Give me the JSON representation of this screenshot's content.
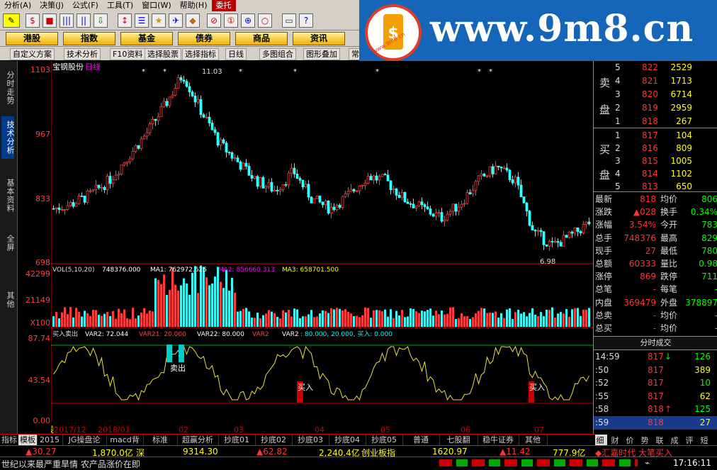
{
  "menu": {
    "items": [
      "分析(A)",
      "决策(J)",
      "公式(F)",
      "工具(T)",
      "窗口(W)",
      "帮助(H)",
      "委托"
    ]
  },
  "toolbar_icons": [
    "$",
    "■",
    "|||",
    "||",
    "⇩",
    "↕",
    "☰",
    "★",
    "✈",
    "◆",
    "⊘",
    "①",
    "⊕",
    "○",
    "▭",
    "?"
  ],
  "toolbar2": {
    "buttons": [
      "港股",
      "指数",
      "基金",
      "债券",
      "商品",
      "资讯"
    ]
  },
  "toolbar3": {
    "buttons": [
      "自定义方案",
      "技术分析",
      "F10资料",
      "选择股票",
      "选择指标",
      "日线",
      "多图组合",
      "图形叠加",
      "常"
    ]
  },
  "logo": {
    "text": "www.9m8.cn",
    "sub": "www.9m8.cn"
  },
  "left_tabs": [
    "分时走势",
    "技术分析",
    "基本资料",
    "全屏",
    "其他"
  ],
  "chart": {
    "stock_label": "宝钢股份",
    "period": "日线",
    "price_ticks": [
      "1103",
      "967",
      "833",
      "698"
    ],
    "high_label": "11.03",
    "low_label": "6.98",
    "vol_ticks": [
      "42299",
      "21149",
      "X100"
    ],
    "vol_legend": {
      "name": "VOL(5,10,20)",
      "v": "748376.000",
      "ma1": "MA1: 762972.625",
      "ma2": "MA2: 856660.313",
      "ma3": "MA3: 658701.500"
    },
    "ind_ticks": [
      "87.74",
      "43.54",
      "0.00"
    ],
    "ind_legend": {
      "name": "买入卖出",
      "var2": "VAR2: 72.044",
      "var21": "VAR21: 20.000",
      "var22": "VAR22: 80.000",
      "var2a": "VAR2",
      "var2b": "VAR2",
      "vals": ": 80.000, 20.000, 买入: 0.000"
    },
    "sell_label": "卖出",
    "buy_label1": "买入",
    "buy_label2": "买入",
    "date_labels": [
      "2017/12",
      "2018/01",
      "02",
      "03",
      "04",
      "05",
      "06",
      "07"
    ],
    "period_tag": "日线"
  },
  "chart_data": {
    "type": "candlestick",
    "ylim": [
      6.98,
      11.03
    ],
    "x": [
      "2017/12",
      "2018/01",
      "02",
      "03",
      "04",
      "05",
      "06",
      "07"
    ],
    "close_trend": [
      8.0,
      8.1,
      8.3,
      8.6,
      9.1,
      9.6,
      10.2,
      10.9,
      10.1,
      9.4,
      9.0,
      8.6,
      8.4,
      8.8,
      8.2,
      8.0,
      8.3,
      8.7,
      8.6,
      8.2,
      8.0,
      7.8,
      8.1,
      8.6,
      8.9,
      8.6,
      7.5,
      7.2,
      7.4,
      7.7
    ]
  },
  "quote": {
    "sell": [
      {
        "n": "5",
        "p": "822",
        "v": "2529"
      },
      {
        "n": "4",
        "p": "821",
        "v": "1713"
      },
      {
        "n": "3",
        "p": "820",
        "v": "6714"
      },
      {
        "n": "2",
        "p": "819",
        "v": "2959"
      },
      {
        "n": "1",
        "p": "818",
        "v": "267"
      }
    ],
    "buy": [
      {
        "n": "1",
        "p": "817",
        "v": "104"
      },
      {
        "n": "2",
        "p": "816",
        "v": "809"
      },
      {
        "n": "3",
        "p": "815",
        "v": "1005"
      },
      {
        "n": "4",
        "p": "814",
        "v": "1102"
      },
      {
        "n": "5",
        "p": "813",
        "v": "650"
      }
    ],
    "sell_label": [
      "卖",
      "盘"
    ],
    "buy_label": [
      "买",
      "盘"
    ],
    "stats": [
      {
        "l1": "最新",
        "v1": "818",
        "l2": "均价",
        "v2": "806"
      },
      {
        "l1": "涨跌",
        "v1": "▲028",
        "l2": "换手",
        "v2": "0.34%"
      },
      {
        "l1": "涨幅",
        "v1": "3.54%",
        "l2": "今开",
        "v2": "783"
      },
      {
        "l1": "总手",
        "v1": "748376",
        "l2": "最高",
        "v2": "829"
      },
      {
        "l1": "现手",
        "v1": "27",
        "l2": "最低",
        "v2": "780"
      },
      {
        "l1": "总额",
        "v1": "60333",
        "l2": "量比",
        "v2": "0.98"
      },
      {
        "l1": "涨停",
        "v1": "869",
        "l2": "跌停",
        "v2": "711"
      },
      {
        "l1": "总笔",
        "v1": "-",
        "l2": "每笔",
        "v2": "-"
      },
      {
        "l1": "内盘",
        "v1": "369479",
        "l2": "外盘",
        "v2": "378897"
      },
      {
        "l1": "总卖",
        "v1": "-",
        "l2": "均价",
        "v2": "-"
      },
      {
        "l1": "总买",
        "v1": "-",
        "l2": "均价",
        "v2": "-"
      }
    ],
    "ticks_title": "分时成交",
    "ticks": [
      {
        "t": "14:59",
        "p": "817",
        "arrow": "↓",
        "v": "126"
      },
      {
        "t": ":50",
        "p": "817",
        "arrow": "",
        "v": "389"
      },
      {
        "t": ":52",
        "p": "817",
        "arrow": "",
        "v": "10"
      },
      {
        "t": ":55",
        "p": "817",
        "arrow": "",
        "v": "62"
      },
      {
        "t": ":58",
        "p": "818",
        "arrow": "↑",
        "v": "125"
      },
      {
        "t": ":59",
        "p": "818",
        "arrow": "",
        "v": "27"
      }
    ],
    "bottom_tabs": [
      "细",
      "财",
      "价",
      "势",
      "联",
      "成",
      "评",
      "短"
    ]
  },
  "bottom_tabs": [
    "指标",
    "模板",
    "2015",
    "JG操盘论",
    "macd背离",
    "标准",
    "超赢分析",
    "抄底01",
    "抄底02",
    "抄底03",
    "抄底04",
    "抄底05",
    "普通",
    "七股翻",
    "稳牛证券",
    "其他"
  ],
  "status1": [
    {
      "a": "▲",
      "v": "30.27",
      "c": "#f33"
    },
    {
      "a": "",
      "v": "1,870.0亿",
      "c": "#ff0"
    },
    {
      "a": "",
      "v": "深",
      "c": "#ff0"
    },
    {
      "a": "",
      "v": "9314.30",
      "c": "#ff0"
    },
    {
      "a": "▲",
      "v": "62.82",
      "c": "#f33"
    },
    {
      "a": "",
      "v": "2,240.4亿",
      "c": "#ff0"
    },
    {
      "a": "",
      "v": "创业板指",
      "c": "#ff0"
    },
    {
      "a": "",
      "v": "1620.97",
      "c": "#ff0"
    },
    {
      "a": "▲",
      "v": "11.42",
      "c": "#f33"
    },
    {
      "a": "",
      "v": "777.9亿",
      "c": "#ff0"
    },
    {
      "a": "◆",
      "v": "汇嘉时代 大笔买入",
      "c": "#f33"
    }
  ],
  "ticker": "世纪以来最严重旱情 农产品涨价在即",
  "clock": "17:16:11"
}
